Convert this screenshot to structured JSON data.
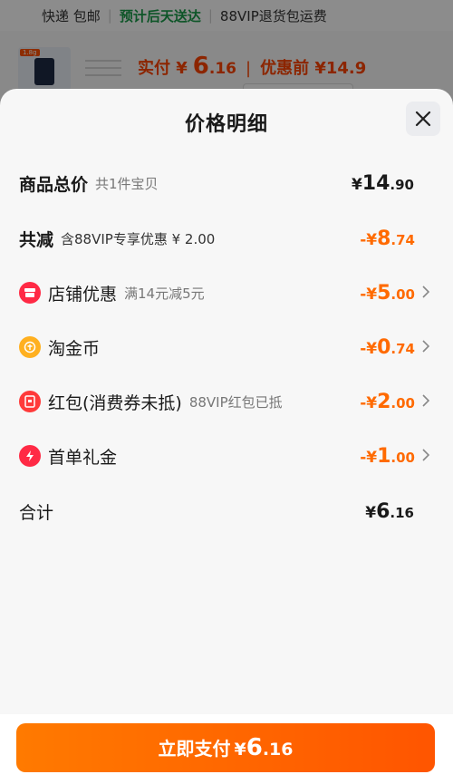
{
  "background": {
    "strip": {
      "item1": "快递 包邮",
      "item2": "预计后天送达",
      "item3": "88VIP退货包运费"
    },
    "product": {
      "tag": "1.8g",
      "pay_label": "实付 ¥",
      "pay_int": "6",
      "pay_dec": ".16",
      "before_label": "优惠前 ¥14.9"
    }
  },
  "sheet": {
    "title": "价格明细",
    "rows": [
      {
        "label": "商品总价",
        "sub": "共1件宝贝",
        "currency": "¥",
        "int": "14",
        "dec": ".90"
      },
      {
        "label": "共减",
        "sub": "含88VIP专享优惠 ¥ 2.00",
        "currency": "-¥",
        "int": "8",
        "dec": ".74"
      },
      {
        "label": "店铺优惠",
        "sub": "满14元减5元",
        "currency": "-¥",
        "int": "5",
        "dec": ".00",
        "icon": "shop-icon"
      },
      {
        "label": "淘金币",
        "sub": "",
        "currency": "-¥",
        "int": "0",
        "dec": ".74",
        "icon": "coin-icon"
      },
      {
        "label": "红包(消费券未抵)",
        "sub": "88VIP红包已抵",
        "currency": "-¥",
        "int": "2",
        "dec": ".00",
        "icon": "red-packet-icon"
      },
      {
        "label": "首单礼金",
        "sub": "",
        "currency": "-¥",
        "int": "1",
        "dec": ".00",
        "icon": "lightning-icon"
      },
      {
        "label": "合计",
        "sub": "",
        "currency": "¥",
        "int": "6",
        "dec": ".16"
      }
    ]
  },
  "footer": {
    "button_label": "立即支付",
    "currency": "¥",
    "int": "6",
    "dec": ".16"
  },
  "colors": {
    "accent": "#ff6a00",
    "button_start": "#ff7a00",
    "button_end": "#ff5500",
    "shop_icon": "#ff2a45",
    "coin_icon": "#ffb020",
    "packet_icon": "#ff3a3a",
    "lightning_icon": "#ff2a45"
  }
}
